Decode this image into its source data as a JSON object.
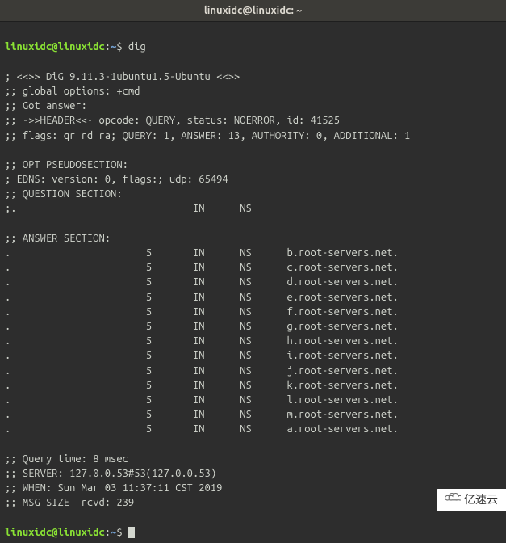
{
  "titlebar": "linuxidc@linuxidc: ~",
  "prompt": {
    "user": "linuxidc@linuxidc",
    "colon": ":",
    "path": "~",
    "dollar": "$ "
  },
  "command": "dig",
  "output": {
    "banner": "; <<>> DiG 9.11.3-1ubuntu1.5-Ubuntu <<>>",
    "global_options": ";; global options: +cmd",
    "got_answer": ";; Got answer:",
    "header": ";; ->>HEADER<<- opcode: QUERY, status: NOERROR, id: 41525",
    "flags": ";; flags: qr rd ra; QUERY: 1, ANSWER: 13, AUTHORITY: 0, ADDITIONAL: 1",
    "opt_section": ";; OPT PSEUDOSECTION:",
    "edns": "; EDNS: version: 0, flags:; udp: 65494",
    "question_section": ";; QUESTION SECTION:",
    "question_line": ";.                              IN      NS",
    "answer_section": ";; ANSWER SECTION:",
    "answers": [
      ".                       5       IN      NS      b.root-servers.net.",
      ".                       5       IN      NS      c.root-servers.net.",
      ".                       5       IN      NS      d.root-servers.net.",
      ".                       5       IN      NS      e.root-servers.net.",
      ".                       5       IN      NS      f.root-servers.net.",
      ".                       5       IN      NS      g.root-servers.net.",
      ".                       5       IN      NS      h.root-servers.net.",
      ".                       5       IN      NS      i.root-servers.net.",
      ".                       5       IN      NS      j.root-servers.net.",
      ".                       5       IN      NS      k.root-servers.net.",
      ".                       5       IN      NS      l.root-servers.net.",
      ".                       5       IN      NS      m.root-servers.net.",
      ".                       5       IN      NS      a.root-servers.net."
    ],
    "query_time": ";; Query time: 8 msec",
    "server": ";; SERVER: 127.0.0.53#53(127.0.0.53)",
    "when": ";; WHEN: Sun Mar 03 11:37:11 CST 2019",
    "msg_size": ";; MSG SIZE  rcvd: 239"
  },
  "watermark": "亿速云"
}
